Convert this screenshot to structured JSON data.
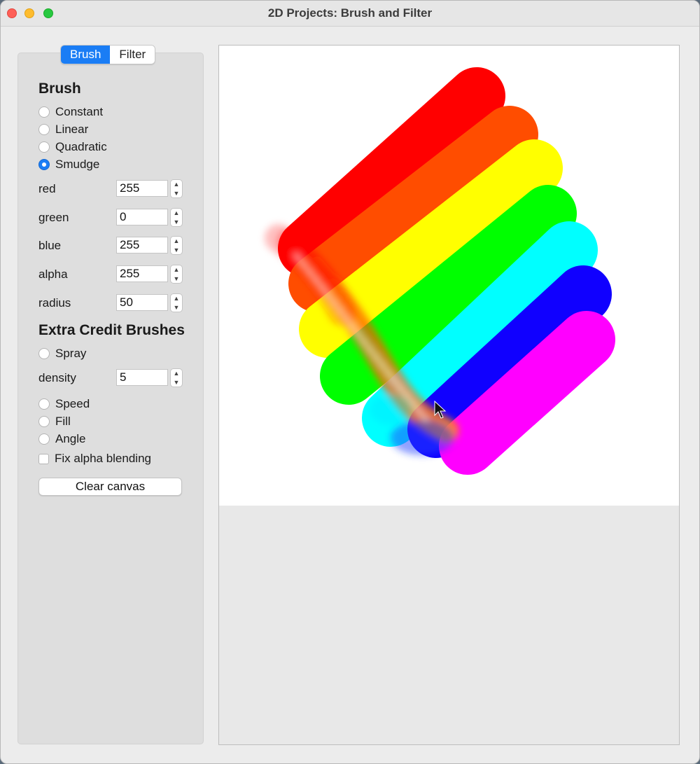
{
  "window": {
    "title": "2D Projects: Brush and Filter"
  },
  "tabs": {
    "brush": "Brush",
    "filter": "Filter",
    "active": "Brush"
  },
  "brush_section": {
    "title": "Brush",
    "options": [
      {
        "label": "Constant",
        "selected": false
      },
      {
        "label": "Linear",
        "selected": false
      },
      {
        "label": "Quadratic",
        "selected": false
      },
      {
        "label": "Smudge",
        "selected": true
      }
    ],
    "fields": {
      "red": {
        "label": "red",
        "value": "255"
      },
      "green": {
        "label": "green",
        "value": "0"
      },
      "blue": {
        "label": "blue",
        "value": "255"
      },
      "alpha": {
        "label": "alpha",
        "value": "255"
      },
      "radius": {
        "label": "radius",
        "value": "50"
      }
    }
  },
  "extra_section": {
    "title": "Extra Credit Brushes",
    "spray": {
      "label": "Spray",
      "selected": false
    },
    "density": {
      "label": "density",
      "value": "5"
    },
    "speed": {
      "label": "Speed",
      "selected": false
    },
    "fill": {
      "label": "Fill",
      "selected": false
    },
    "angle": {
      "label": "Angle",
      "selected": false
    },
    "fix_alpha": {
      "label": "Fix alpha blending",
      "checked": false
    }
  },
  "clear_button": {
    "label": "Clear canvas"
  },
  "colors": {
    "accent": "#1a7df5",
    "strokes": [
      "#ff0000",
      "#ff4d00",
      "#ffff00",
      "#00ff00",
      "#00ffff",
      "#1000ff",
      "#ff00ff"
    ]
  }
}
